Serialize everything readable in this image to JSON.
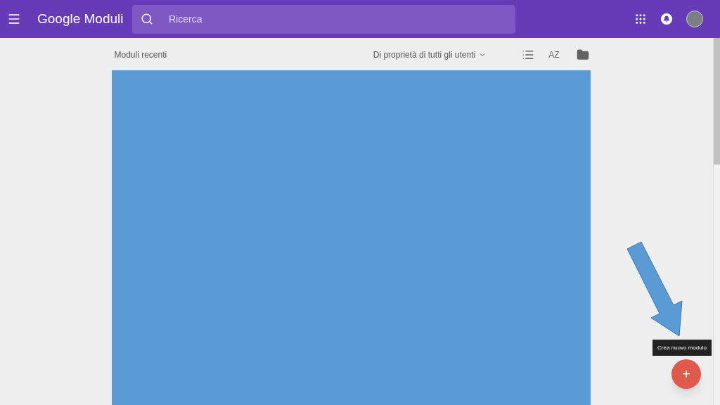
{
  "header": {
    "app_name": "Google Moduli",
    "search": {
      "placeholder": "Ricerca"
    }
  },
  "toolbar": {
    "title": "Moduli recenti",
    "owner_filter": "Di proprietà di tutti gli utenti",
    "sort_label": "AZ"
  },
  "fab": {
    "tooltip": "Crea nuovo modulo",
    "label": "+"
  }
}
